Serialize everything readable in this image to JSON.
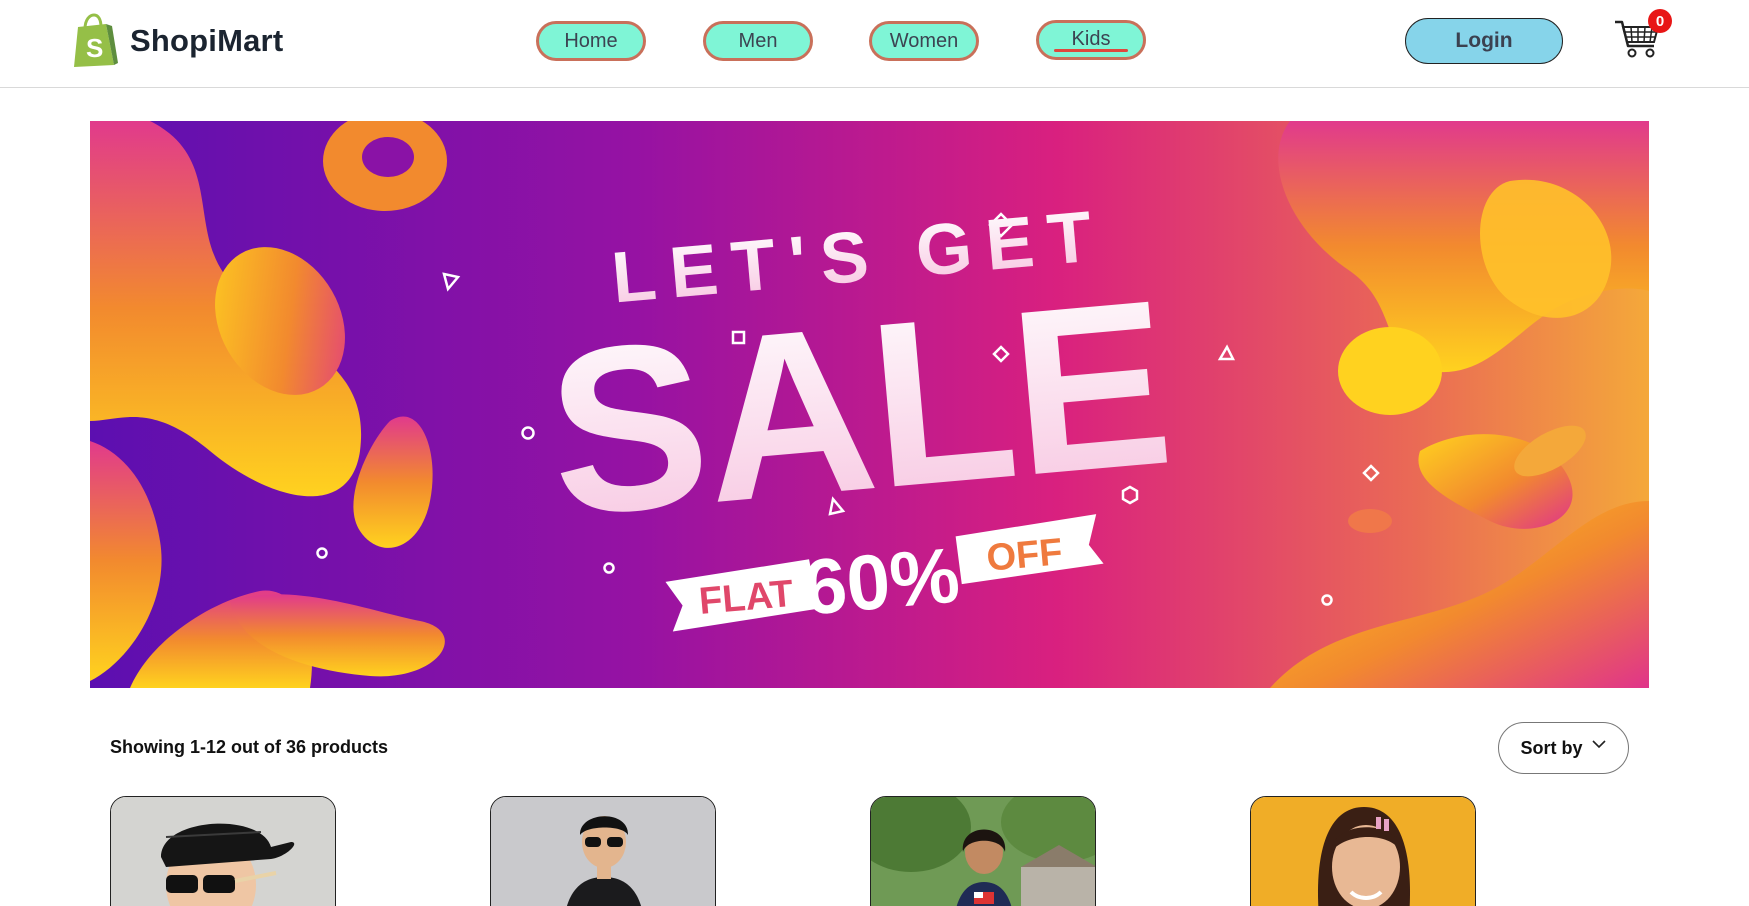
{
  "brand": {
    "name": "ShopiMart",
    "logo_icon": "shopify-bag-icon",
    "logo_color": "#95bf47"
  },
  "nav": {
    "items": [
      {
        "label": "Home",
        "active": false
      },
      {
        "label": "Men",
        "active": false
      },
      {
        "label": "Women",
        "active": false
      },
      {
        "label": "Kids",
        "active": true
      }
    ],
    "pill_color": "#7ff5d6",
    "pill_border": "#c9705a",
    "active_underline": "#e0473e"
  },
  "header": {
    "login_label": "Login",
    "login_color": "#86d4ea",
    "cart_icon": "shopping-cart-icon",
    "cart_count": "0"
  },
  "banner": {
    "line1": "LET'S GET",
    "line2": "SALE",
    "flat": "FLAT",
    "percent": "60%",
    "off": "OFF",
    "colors": {
      "purple": "#6a0dad",
      "magenta": "#d9207f",
      "orange": "#f28a2e",
      "yellow": "#ffd21f"
    }
  },
  "products": {
    "results_text": "Showing 1-12 out of 36 products",
    "sort_label": "Sort by",
    "sort_icon": "chevron-down-icon",
    "cards": [
      {
        "name": "product-card-1",
        "image": "boy-cap-sunglasses"
      },
      {
        "name": "product-card-2",
        "image": "boy-sunglasses-black-tee"
      },
      {
        "name": "product-card-3",
        "image": "girl-outdoor-park"
      },
      {
        "name": "product-card-4",
        "image": "girl-yellow-background"
      }
    ]
  }
}
